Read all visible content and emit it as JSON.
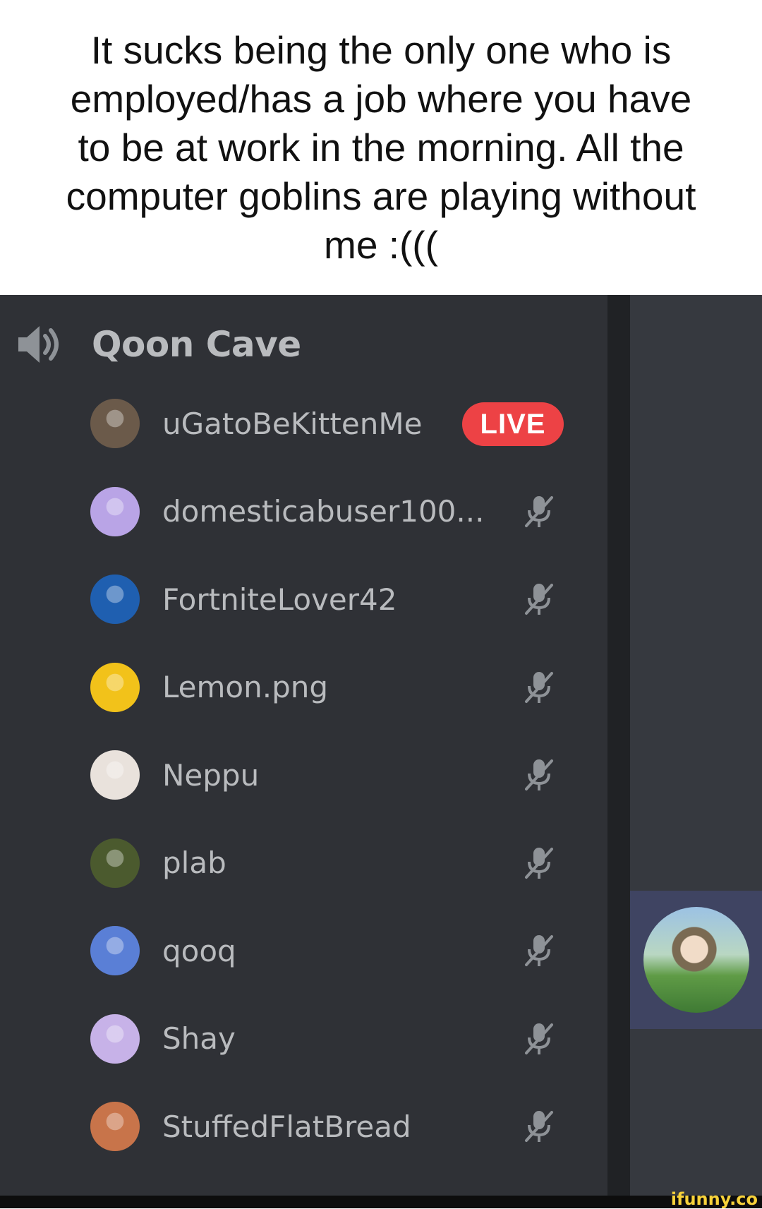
{
  "caption": "It sucks being the only one who is\nemployed/has a job where you have\nto be at work in the morning. All the\ncomputer goblins are playing without\nme :(((",
  "channel": {
    "name": "Qoon Cave",
    "icon": "speaker-icon"
  },
  "live_label": "LIVE",
  "members": [
    {
      "name": "uGatoBeKittenMe",
      "status": "live",
      "avatar_color": "#6b5a4a"
    },
    {
      "name": "domesticabuser100...",
      "status": "muted",
      "avatar_color": "#b9a4e6"
    },
    {
      "name": "FortniteLover42",
      "status": "muted",
      "avatar_color": "#1f5fb0"
    },
    {
      "name": "Lemon.png",
      "status": "muted",
      "avatar_color": "#f2c21a"
    },
    {
      "name": "Neppu",
      "status": "muted",
      "avatar_color": "#e9e2dc"
    },
    {
      "name": "plab",
      "status": "muted",
      "avatar_color": "#4b5a2e"
    },
    {
      "name": "qooq",
      "status": "muted",
      "avatar_color": "#5a7fd6"
    },
    {
      "name": "Shay",
      "status": "muted",
      "avatar_color": "#c7b2e8"
    },
    {
      "name": "StuffedFlatBread",
      "status": "muted",
      "avatar_color": "#c8744a"
    }
  ],
  "colors": {
    "background": "#2f3136",
    "text": "#b9bbbe",
    "live": "#ed4245",
    "active_tile": "#3f4462"
  },
  "watermark": "ifunny.co"
}
